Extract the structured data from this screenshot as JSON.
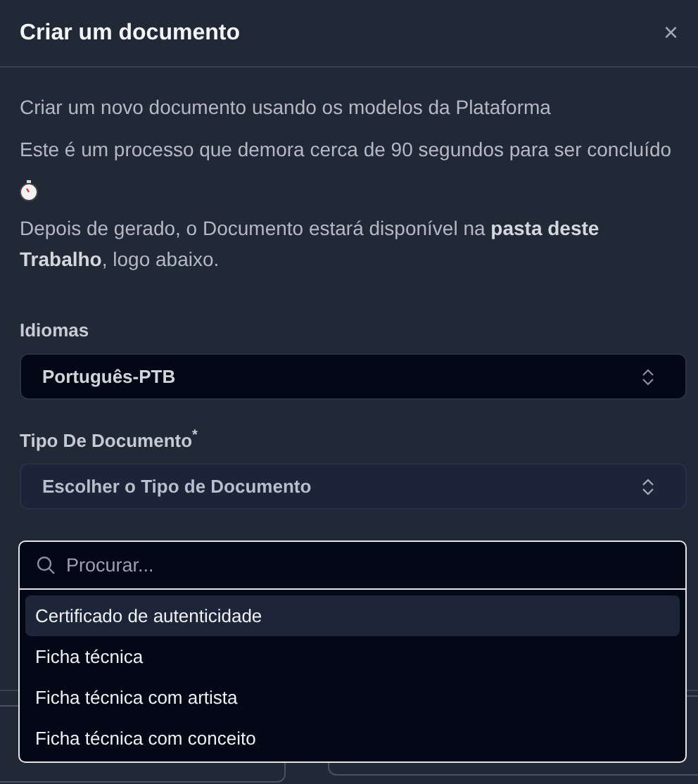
{
  "dialog": {
    "title": "Criar um documento",
    "close": "×"
  },
  "paragraphs": [
    "Criar um novo documento usando os modelos da Plataforma",
    "Este é um processo que demora cerca de 90 segundos para ser concluído"
  ],
  "note": "Depois de gerado, o Documento estará disponível na **pasta deste Trabalho**, logo abaixo.",
  "language_field": {
    "label": "Idiomas",
    "value": "Português-PTB"
  },
  "type_field": {
    "label": "Tipo De Documento",
    "required_mark": "*",
    "placeholder": "Escolher o Tipo de Documento"
  },
  "dropdown": {
    "search_placeholder": "Procurar...",
    "options": [
      {
        "label": "Certificado de autenticidade",
        "selected": true
      },
      {
        "label": "Ficha técnica",
        "selected": false
      },
      {
        "label": "Ficha técnica com artista",
        "selected": false
      },
      {
        "label": "Ficha técnica com conceito",
        "selected": false
      }
    ]
  }
}
